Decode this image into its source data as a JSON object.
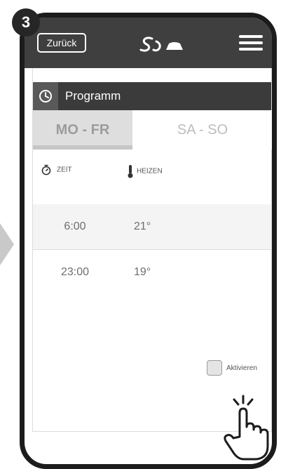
{
  "step": {
    "number": "3"
  },
  "header": {
    "back_label": "Zurück",
    "logo_icon": "brand-logo",
    "menu_icon": "hamburger-menu-icon"
  },
  "program": {
    "title": "Programm",
    "icon": "clock-icon"
  },
  "tabs": [
    {
      "label": "MO - FR",
      "active": true
    },
    {
      "label": "SA - SO",
      "active": false
    }
  ],
  "columns": {
    "time": "ZEIT",
    "heat": "HEIZEN"
  },
  "schedule": [
    {
      "time": "6:00",
      "temp": "21°"
    },
    {
      "time": "23:00",
      "temp": "19°"
    }
  ],
  "activate": {
    "label": "Aktivieren",
    "checked": false
  },
  "colors": {
    "header": "#3f3f3f",
    "program_bar": "#3b3b3b",
    "active_tab": "#dedede"
  }
}
